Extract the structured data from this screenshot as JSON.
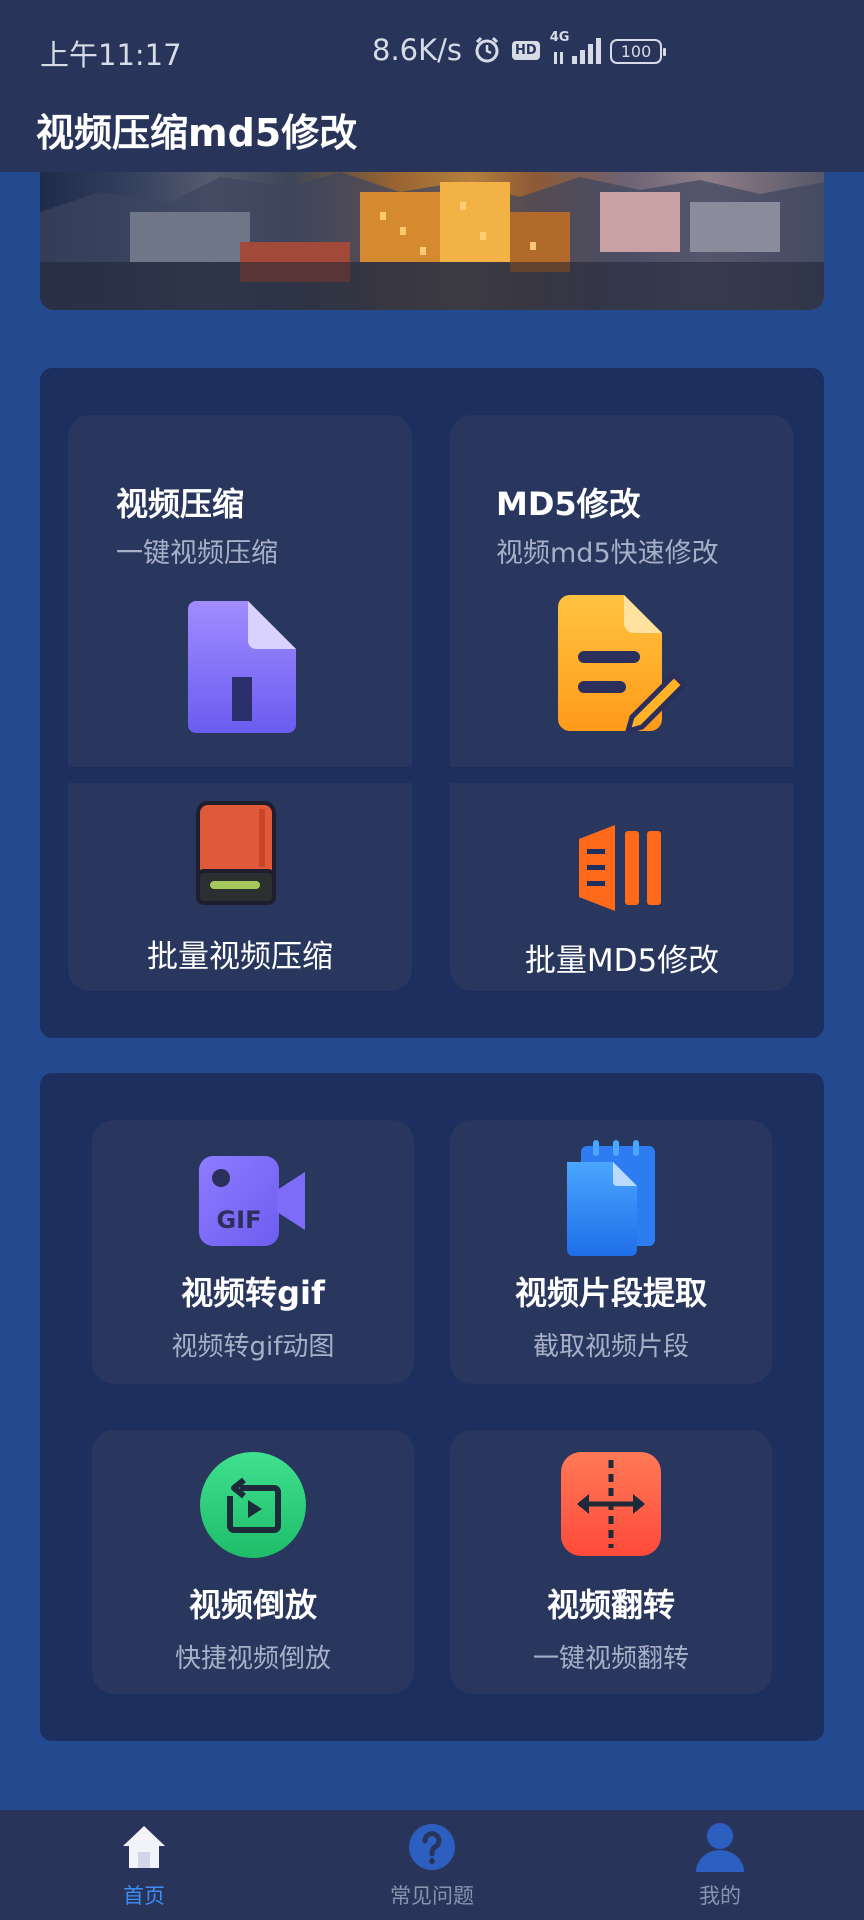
{
  "status_bar": {
    "time": "上午11:17",
    "network_speed": "8.6K/s",
    "network_type": "4G",
    "hd_badge": "HD",
    "battery": "100"
  },
  "app": {
    "title": "视频压缩md5修改"
  },
  "section1": {
    "compress": {
      "title": "视频压缩",
      "subtitle": "一键视频压缩"
    },
    "md5": {
      "title": "MD5修改",
      "subtitle": "视频md5快速修改"
    },
    "batch_compress": {
      "label": "批量视频压缩"
    },
    "batch_md5": {
      "label": "批量MD5修改"
    }
  },
  "section2": {
    "gif": {
      "title": "视频转gif",
      "subtitle": "视频转gif动图",
      "icon_text": "GIF"
    },
    "clip": {
      "title": "视频片段提取",
      "subtitle": "截取视频片段"
    },
    "reverse": {
      "title": "视频倒放",
      "subtitle": "快捷视频倒放"
    },
    "flip": {
      "title": "视频翻转",
      "subtitle": "一键视频翻转"
    }
  },
  "tabbar": {
    "home": "首页",
    "faq": "常见问题",
    "mine": "我的"
  },
  "colors": {
    "background": "#234a8f",
    "panel": "#1d2f5e",
    "card": "#29365e",
    "topbar": "#28345a",
    "active_tab": "#3c8ef5"
  }
}
